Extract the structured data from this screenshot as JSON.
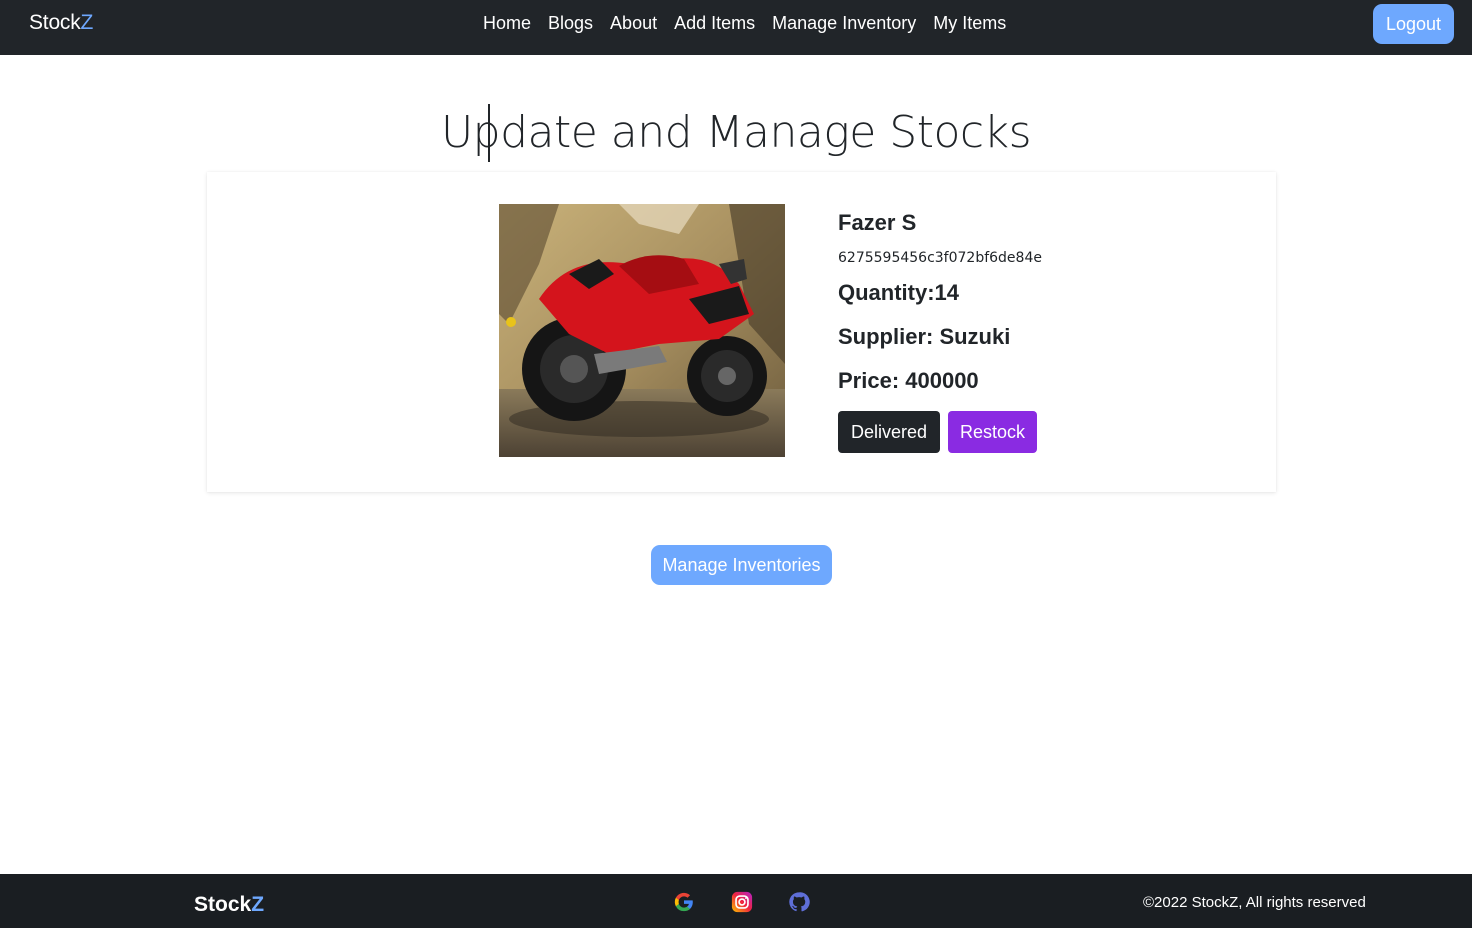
{
  "navbar": {
    "brand_main": "Stock",
    "brand_accent": "Z",
    "links": [
      "Home",
      "Blogs",
      "About",
      "Add Items",
      "Manage Inventory",
      "My Items"
    ],
    "logout_label": "Logout"
  },
  "page": {
    "title": "Update and Manage Stocks"
  },
  "product": {
    "image_icon": "motorcycle-photo",
    "name": "Fazer S",
    "id": "6275595456c3f072bf6de84e",
    "quantity": "Quantity:14",
    "supplier": "Supplier: Suzuki",
    "price": "Price: 400000",
    "delivered_label": "Delivered",
    "restock_label": "Restock"
  },
  "manage_button_label": "Manage Inventories",
  "footer": {
    "brand_main": "Stock",
    "brand_accent": "Z",
    "social_icons": [
      "google-icon",
      "instagram-icon",
      "github-icon"
    ],
    "copyright": "©2022 StockZ, All rights reserved"
  },
  "colors": {
    "navbar_bg": "#212529",
    "accent_blue": "#6ea8fe",
    "restock_purple": "#8a2be2",
    "footer_bg": "#1a1e22"
  }
}
